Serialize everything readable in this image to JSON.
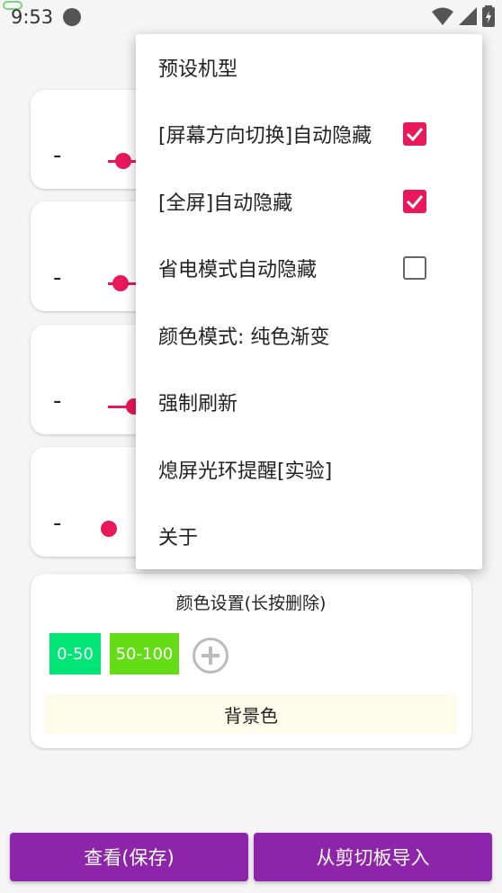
{
  "status_bar": {
    "time": "9:53"
  },
  "menu": {
    "items": [
      {
        "label": "预设机型",
        "has_checkbox": false
      },
      {
        "label": "[屏幕方向切换]自动隐藏",
        "has_checkbox": true,
        "checked": true
      },
      {
        "label": "[全屏]自动隐藏",
        "has_checkbox": true,
        "checked": true
      },
      {
        "label": "省电模式自动隐藏",
        "has_checkbox": true,
        "checked": false
      },
      {
        "label": "颜色模式: 纯色渐变",
        "has_checkbox": false
      },
      {
        "label": "强制刷新",
        "has_checkbox": false
      },
      {
        "label": "熄屏光环提醒[实验]",
        "has_checkbox": false
      },
      {
        "label": "关于",
        "has_checkbox": false
      }
    ]
  },
  "sliders": {
    "minus_label": "-",
    "items": [
      {},
      {},
      {},
      {}
    ]
  },
  "color_settings": {
    "title": "颜色设置(长按删除)",
    "chips": [
      {
        "label": "0-50",
        "color": "#00e676"
      },
      {
        "label": "50-100",
        "color": "#64dd17"
      }
    ],
    "background_label": "背景色"
  },
  "buttons": {
    "view_save": "查看(保存)",
    "import_clipboard": "从剪切板导入"
  },
  "colors": {
    "accent": "#e8185a",
    "primary": "#8e24aa"
  }
}
